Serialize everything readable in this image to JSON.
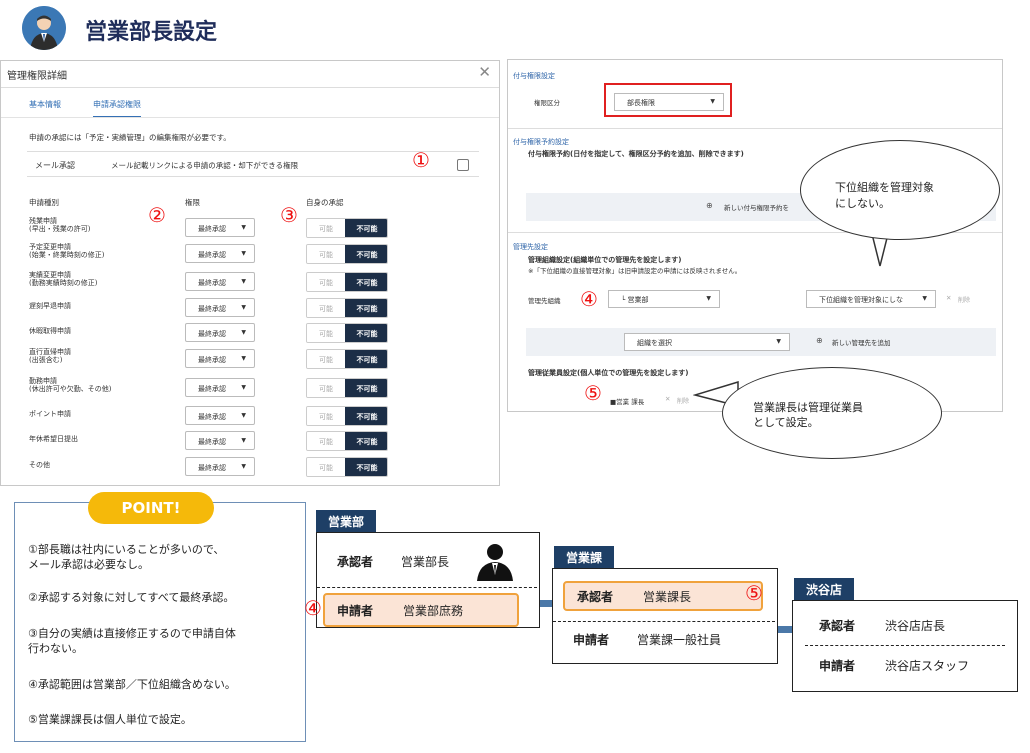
{
  "header": {
    "title": "営業部長設定"
  },
  "left_panel": {
    "title": "管理権限詳細",
    "tabs": [
      "基本情報",
      "申請承認権限"
    ],
    "description": "申請の承認には「予定・実績管理」の編集権限が必要です。",
    "mail_label": "メール承認",
    "mail_desc": "メール記載リンクによる申請の承認・却下ができる権限",
    "col_type": "申請種別",
    "col_auth": "権限",
    "col_self": "自身の承認",
    "select_value": "最終承認",
    "toggle_on": "可能",
    "toggle_off": "不可能",
    "rows": [
      {
        "l1": "残業申請",
        "l2": "(早出・残業の許可)"
      },
      {
        "l1": "予定変更申請",
        "l2": "(始業・終業時刻の修正)"
      },
      {
        "l1": "実績変更申請",
        "l2": "(勤務実績時刻の修正)"
      },
      {
        "l1": "遅刻早退申請",
        "l2": ""
      },
      {
        "l1": "休暇取得申請",
        "l2": ""
      },
      {
        "l1": "直行直帰申請",
        "l2": "(出張含む)"
      },
      {
        "l1": "勤務申請",
        "l2": "(休出許可や欠勤、その他)"
      },
      {
        "l1": "ポイント申請",
        "l2": ""
      },
      {
        "l1": "年休希望日提出",
        "l2": ""
      },
      {
        "l1": "その他",
        "l2": ""
      }
    ]
  },
  "markers": {
    "m1": "①",
    "m2": "②",
    "m3": "③",
    "m4": "④",
    "m5": "⑤"
  },
  "right_panel": {
    "grant_title": "付与権限設定",
    "grant_label": "権限区分",
    "grant_value": "部長権限",
    "reserve_title": "付与権限予約設定",
    "reserve_desc": "付与権限予約(日付を指定して、権限区分予約を追加、削除できます)",
    "reserve_add": "新しい付与権限予約を",
    "mgmt_title": "管理先設定",
    "org_setting": "管理組織設定(組織単位での管理先を設定します)",
    "org_note": "※「下位組織の直接管理対象」は旧申請設定の申請には反映されません。",
    "org_label": "管理先組織",
    "org_value": "└ 営業部",
    "sub_value": "下位組織を管理対象にしな",
    "delete": "削除",
    "select_org": "組織を選択",
    "add_mgmt": "新しい管理先を追加",
    "emp_setting": "管理従業員設定(個人単位での管理先を設定します)",
    "emp_value": "■営業 課長"
  },
  "bubbles": {
    "b1_l1": "下位組織を管理対象",
    "b1_l2": "にしない。",
    "b2_l1": "営業課長は管理従業員",
    "b2_l2": "として設定。"
  },
  "point": {
    "badge": "POINT!",
    "lines": [
      "①部長職は社内にいることが多いので、",
      "メール承認は必要なし。",
      "②承認する対象に対してすべて最終承認。",
      "③自分の実績は直接修正するので申請自体",
      "行わない。",
      "④承認範囲は営業部／下位組織含めない。",
      "⑤営業課課長は個人単位で設定。"
    ]
  },
  "org": {
    "approver": "承認者",
    "applicant": "申請者",
    "d1": {
      "name": "営業部",
      "approver": "営業部長",
      "applicant": "営業部庶務"
    },
    "d2": {
      "name": "営業課",
      "approver": "営業課長",
      "applicant": "営業課一般社員"
    },
    "d3": {
      "name": "渋谷店",
      "approver": "渋谷店店長",
      "applicant": "渋谷店スタッフ"
    }
  }
}
